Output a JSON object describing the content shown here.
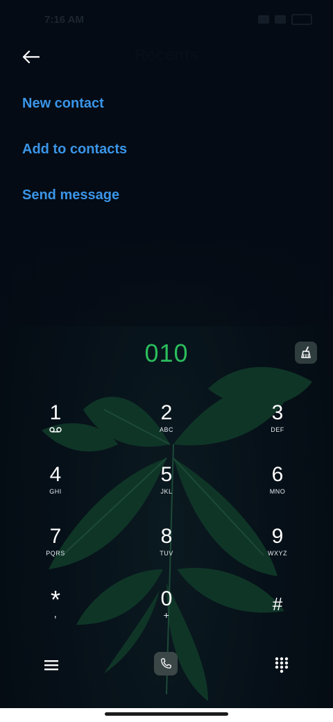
{
  "status_bar": {
    "time": "7:16 AM"
  },
  "header": {
    "title": "Recents",
    "back_icon": "arrow-left-icon"
  },
  "actions": [
    {
      "label": "New contact"
    },
    {
      "label": "Add to contacts"
    },
    {
      "label": "Send message"
    }
  ],
  "dialed_number": "010",
  "keypad": {
    "k1": {
      "digit": "1"
    },
    "k2": {
      "digit": "2",
      "letters": "ABC"
    },
    "k3": {
      "digit": "3",
      "letters": "DEF"
    },
    "k4": {
      "digit": "4",
      "letters": "GHI"
    },
    "k5": {
      "digit": "5",
      "letters": "JKL"
    },
    "k6": {
      "digit": "6",
      "letters": "MNO"
    },
    "k7": {
      "digit": "7",
      "letters": "PQRS"
    },
    "k8": {
      "digit": "8",
      "letters": "TUV"
    },
    "k9": {
      "digit": "9",
      "letters": "WXYZ"
    },
    "star": {
      "digit": "*",
      "letters": ","
    },
    "k0": {
      "digit": "0",
      "letters": "+"
    },
    "hash": {
      "digit": "#"
    }
  },
  "colors": {
    "accent_link": "#3a95e8",
    "number_green": "#2bbd5c",
    "background": "#050b14"
  },
  "icons": [
    "arrow-left-icon",
    "voicemail-icon",
    "broom-icon",
    "menu-icon",
    "phone-icon",
    "dialpad-icon"
  ]
}
